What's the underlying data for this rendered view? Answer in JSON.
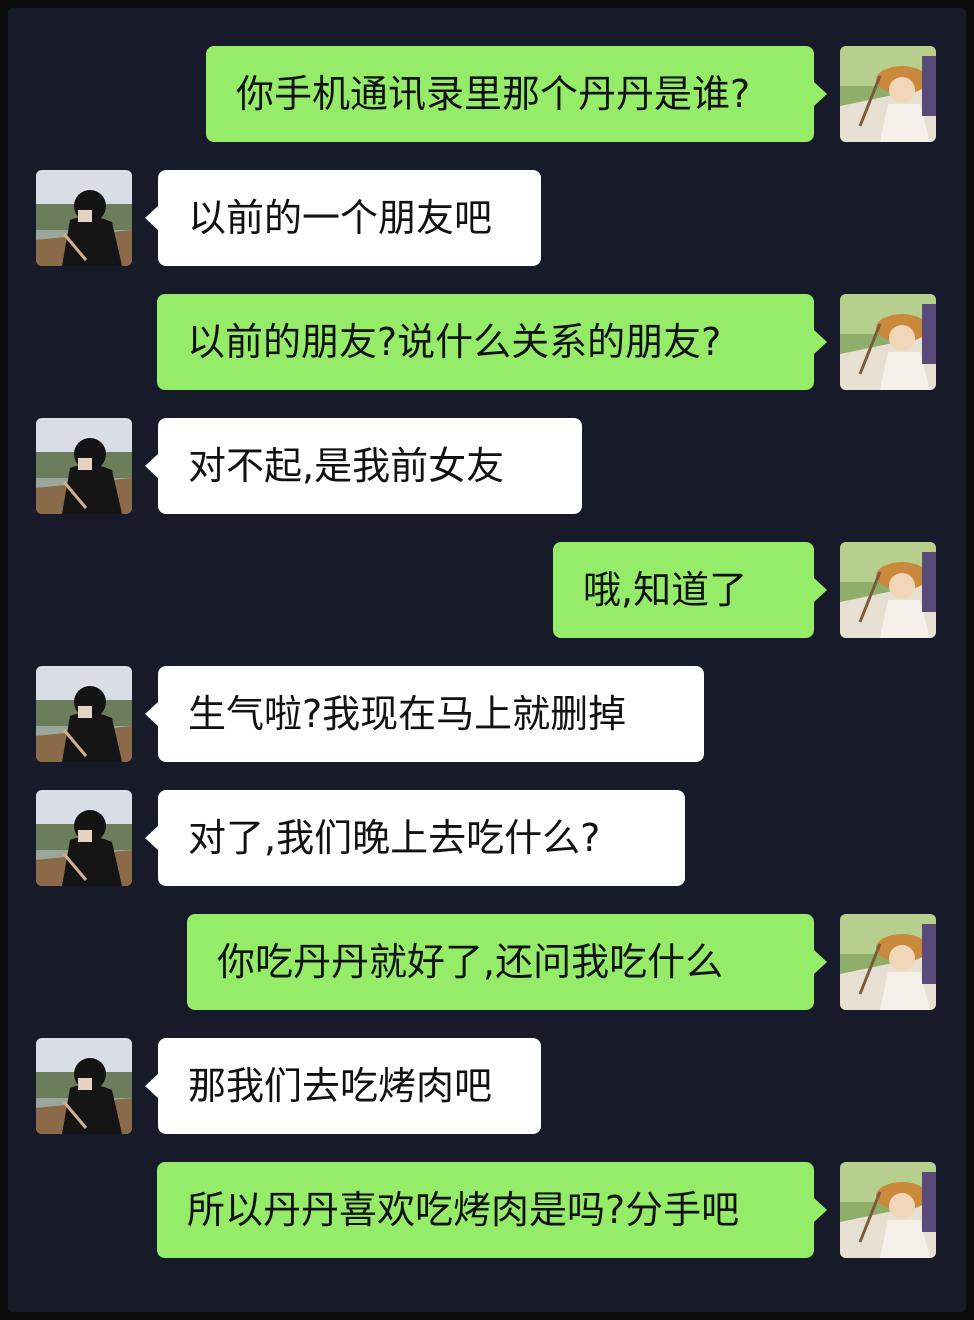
{
  "chat": {
    "messages": [
      {
        "sender": "me",
        "text": "你手机通讯录里那个丹丹是谁?"
      },
      {
        "sender": "other",
        "text": "以前的一个朋友吧"
      },
      {
        "sender": "me",
        "text": "以前的朋友?说什么关系的朋友?"
      },
      {
        "sender": "other",
        "text": "对不起,是我前女友"
      },
      {
        "sender": "me",
        "text": "哦,知道了"
      },
      {
        "sender": "other",
        "text": "生气啦?我现在马上就删掉"
      },
      {
        "sender": "other",
        "text": "对了,我们晚上去吃什么?"
      },
      {
        "sender": "me",
        "text": "你吃丹丹就好了,还问我吃什么"
      },
      {
        "sender": "other",
        "text": "那我们去吃烤肉吧"
      },
      {
        "sender": "me",
        "text": "所以丹丹喜欢吃烤肉是吗?分手吧"
      }
    ]
  },
  "colors": {
    "background": "#171a28",
    "my_bubble": "#95ec69",
    "other_bubble": "#ffffff",
    "text": "#111111"
  },
  "icons": {
    "my_avatar": "girl-with-sunhat-avatar-icon",
    "other_avatar": "boy-in-black-avatar-icon"
  }
}
